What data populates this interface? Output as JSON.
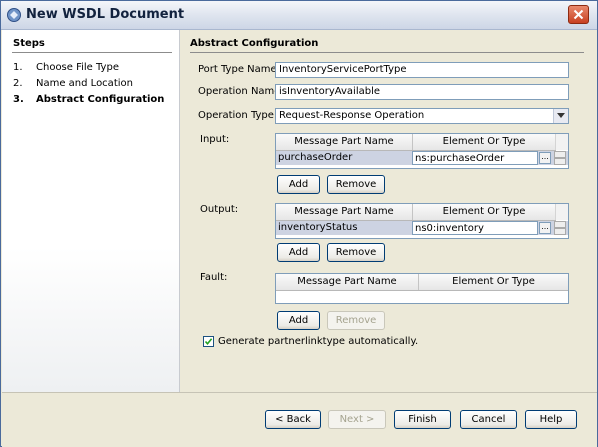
{
  "window": {
    "title": "New WSDL Document",
    "close_icon": "close-icon"
  },
  "steps": {
    "title": "Steps",
    "items": [
      {
        "num": "1.",
        "label": "Choose File Type",
        "current": false
      },
      {
        "num": "2.",
        "label": "Name and Location",
        "current": false
      },
      {
        "num": "3.",
        "label": "Abstract Configuration",
        "current": true
      }
    ]
  },
  "config": {
    "title": "Abstract Configuration",
    "port_type_label": "Port Type Name:",
    "port_type_value": "InventoryServicePortType",
    "operation_name_label": "Operation Name:",
    "operation_name_value": "isInventoryAvailable",
    "operation_type_label": "Operation Type:",
    "operation_type_value": "Request-Response Operation",
    "input": {
      "label": "Input:",
      "columns": [
        "Message Part Name",
        "Element Or Type"
      ],
      "rows": [
        {
          "name": "purchaseOrder",
          "type": "ns:purchaseOrder"
        }
      ],
      "add_label": "Add",
      "remove_label": "Remove"
    },
    "output": {
      "label": "Output:",
      "columns": [
        "Message Part Name",
        "Element Or Type"
      ],
      "rows": [
        {
          "name": "inventoryStatus",
          "type": "ns0:inventory"
        }
      ],
      "add_label": "Add",
      "remove_label": "Remove"
    },
    "fault": {
      "label": "Fault:",
      "columns": [
        "Message Part Name",
        "Element Or Type"
      ],
      "rows": [],
      "add_label": "Add",
      "remove_label": "Remove"
    },
    "partnerlink_label": "Generate partnerlinktype automatically.",
    "partnerlink_checked": true,
    "ellipsis": "..."
  },
  "footer": {
    "back": "< Back",
    "next": "Next >",
    "finish": "Finish",
    "cancel": "Cancel",
    "help": "Help"
  },
  "colors": {
    "accent": "#316ac5",
    "selection_row": "#cdd3e2",
    "close_button": "#c84021"
  }
}
